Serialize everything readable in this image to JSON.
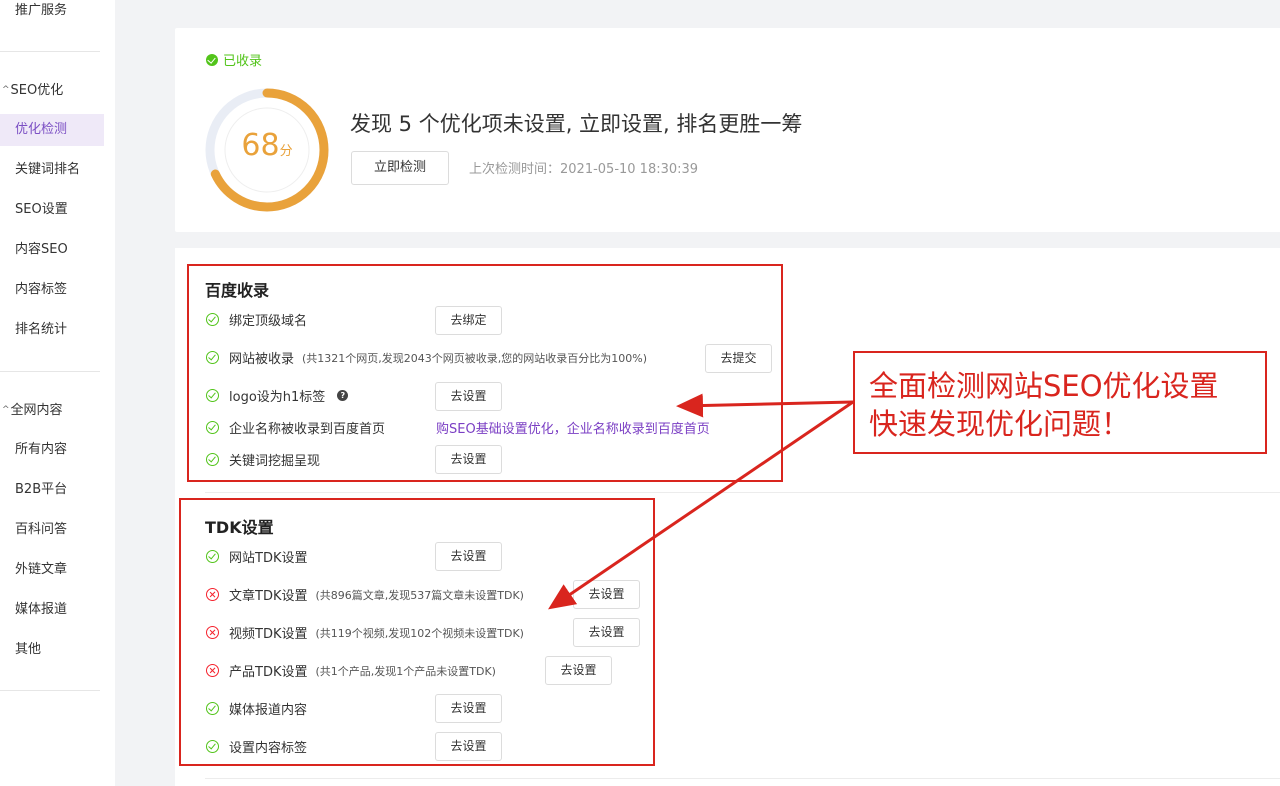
{
  "sidebar": {
    "top_item": "推广服务",
    "seo_group": "SEO优化",
    "seo_items": [
      "优化检测",
      "关键词排名",
      "SEO设置",
      "内容SEO",
      "内容标签",
      "排名统计"
    ],
    "content_group": "全网内容",
    "content_items": [
      "所有内容",
      "B2B平台",
      "百科问答",
      "外链文章",
      "媒体报道",
      "其他"
    ]
  },
  "summary": {
    "status": "已收录",
    "score": "68",
    "score_unit": "分",
    "score_fraction": 0.68,
    "headline": "发现 5 个优化项未设置, 立即设置, 排名更胜一筹",
    "check_button": "立即检测",
    "last_check": "上次检测时间：2021-05-10 18:30:39"
  },
  "baidu": {
    "title": "百度收录",
    "rows": [
      {
        "label": "绑定顶级域名",
        "button": "去绑定"
      },
      {
        "label": "网站被收录",
        "note": "(共1321个网页,发现2043个网页被收录,您的网站收录百分比为100%)",
        "button": "去提交"
      },
      {
        "label": "logo设为h1标签",
        "help": "?",
        "button": "去设置"
      },
      {
        "label": "企业名称被收录到百度首页",
        "link": "购SEO基础设置优化，企业名称收录到百度首页"
      },
      {
        "label": "关键词挖掘呈现",
        "button": "去设置"
      }
    ]
  },
  "tdk": {
    "title": "TDK设置",
    "rows": [
      {
        "label": "网站TDK设置",
        "button": "去设置"
      },
      {
        "label": "文章TDK设置",
        "note": "(共896篇文章,发现537篇文章未设置TDK)",
        "button": "去设置"
      },
      {
        "label": "视频TDK设置",
        "note": "(共119个视频,发现102个视频未设置TDK)",
        "button": "去设置"
      },
      {
        "label": "产品TDK设置",
        "note": "(共1个产品,发现1个产品未设置TDK)",
        "button": "去设置"
      },
      {
        "label": "媒体报道内容",
        "button": "去设置"
      },
      {
        "label": "设置内容标签",
        "button": "去设置"
      }
    ]
  },
  "callout": {
    "line1": "全面检测网站SEO优化设置",
    "line2": "快速发现优化问题！"
  },
  "colors": {
    "accent": "#7b4fc4",
    "ok": "#52c41a",
    "error": "#f5222d",
    "gauge": "#e9a23b",
    "annotation": "#d9251e"
  }
}
